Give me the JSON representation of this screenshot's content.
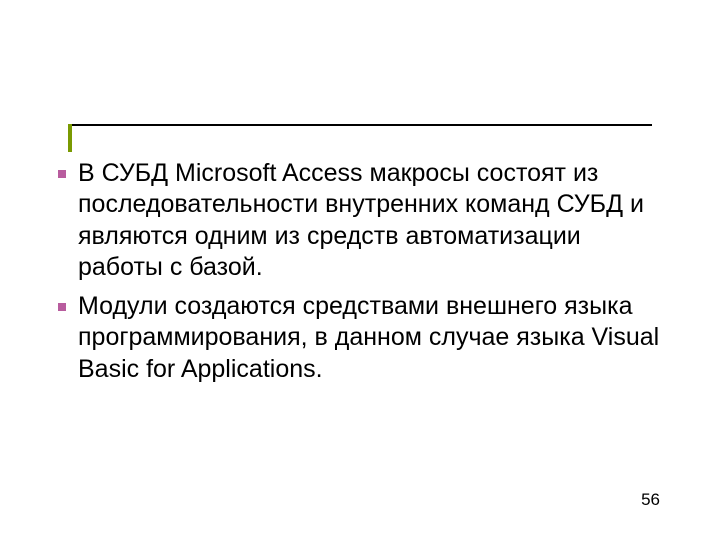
{
  "bullets": [
    "В СУБД Microsoft Access макросы состоят из последовательности внутренних команд СУБД и являются одним из средств автоматизации работы с базой.",
    "Модули создаются средствами внешнего языка программирования, в данном случае языка Visual Basic for Applications."
  ],
  "page_number": "56"
}
